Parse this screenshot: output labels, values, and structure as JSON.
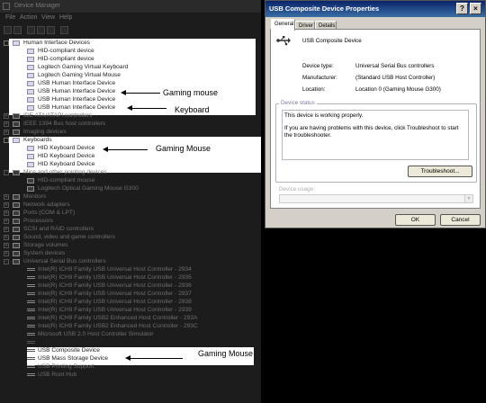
{
  "device_manager": {
    "title": "Device Manager",
    "menu": [
      "File",
      "Action",
      "View",
      "Help"
    ],
    "tree": [
      {
        "id": "hid-cat",
        "text": "Human Interface Devices",
        "level": 0,
        "expander": "-",
        "lit": true
      },
      {
        "id": "hid-1",
        "text": "HID-compliant device",
        "level": 1,
        "lit": true
      },
      {
        "id": "hid-2",
        "text": "HID-compliant device",
        "level": 1,
        "lit": true
      },
      {
        "id": "hid-3",
        "text": "Logitech Gaming Virtual Keyboard",
        "level": 1,
        "lit": true
      },
      {
        "id": "hid-4",
        "text": "Logitech Gaming Virtual Mouse",
        "level": 1,
        "lit": true
      },
      {
        "id": "hid-5",
        "text": "USB Human Interface Device",
        "level": 1,
        "lit": true
      },
      {
        "id": "hid-6",
        "text": "USB Human Interface Device",
        "level": 1,
        "lit": true
      },
      {
        "id": "hid-7",
        "text": "USB Human Interface Device",
        "level": 1,
        "lit": true
      },
      {
        "id": "hid-8",
        "text": "USB Human Interface Device",
        "level": 1,
        "lit": true
      },
      {
        "id": "ide",
        "text": "IDE ATA/ATAPI controllers",
        "level": 0,
        "expander": "+",
        "lit": false
      },
      {
        "id": "ieee",
        "text": "IEEE 1394 Bus host controllers",
        "level": 0,
        "expander": "+",
        "lit": false
      },
      {
        "id": "imaging",
        "text": "Imaging devices",
        "level": 0,
        "expander": "+",
        "lit": false
      },
      {
        "id": "kb-cat",
        "text": "Keyboards",
        "level": 0,
        "expander": "-",
        "lit": true
      },
      {
        "id": "kb-1",
        "text": "HID Keyboard Device",
        "level": 1,
        "lit": true
      },
      {
        "id": "kb-2",
        "text": "HID Keyboard Device",
        "level": 1,
        "lit": true
      },
      {
        "id": "kb-3",
        "text": "HID Keyboard Device",
        "level": 1,
        "lit": true
      },
      {
        "id": "mice-cat",
        "text": "Mice and other pointing devices",
        "level": 0,
        "expander": "-",
        "lit": false
      },
      {
        "id": "mice-1",
        "text": "HID-compliant mouse",
        "level": 1,
        "lit": false
      },
      {
        "id": "mice-2",
        "text": "Logitech Optical Gaming Mouse G300",
        "level": 1,
        "lit": false
      },
      {
        "id": "monitors",
        "text": "Monitors",
        "level": 0,
        "expander": "+",
        "lit": false
      },
      {
        "id": "net",
        "text": "Network adapters",
        "level": 0,
        "expander": "+",
        "lit": false
      },
      {
        "id": "ports",
        "text": "Ports (COM & LPT)",
        "level": 0,
        "expander": "+",
        "lit": false
      },
      {
        "id": "proc",
        "text": "Processors",
        "level": 0,
        "expander": "+",
        "lit": false
      },
      {
        "id": "scsi",
        "text": "SCSI and RAID controllers",
        "level": 0,
        "expander": "+",
        "lit": false
      },
      {
        "id": "sound",
        "text": "Sound, video and game controllers",
        "level": 0,
        "expander": "+",
        "lit": false
      },
      {
        "id": "storage",
        "text": "Storage volumes",
        "level": 0,
        "expander": "+",
        "lit": false
      },
      {
        "id": "system",
        "text": "System devices",
        "level": 0,
        "expander": "+",
        "lit": false
      },
      {
        "id": "usb-cat",
        "text": "Universal Serial Bus controllers",
        "level": 0,
        "expander": "-",
        "lit": false
      },
      {
        "id": "usb-1",
        "text": "Intel(R) ICH9 Family USB Universal Host Controller - 2934",
        "level": 1,
        "lit": false,
        "usb": true
      },
      {
        "id": "usb-2",
        "text": "Intel(R) ICH9 Family USB Universal Host Controller - 2935",
        "level": 1,
        "lit": false,
        "usb": true
      },
      {
        "id": "usb-3",
        "text": "Intel(R) ICH9 Family USB Universal Host Controller - 2936",
        "level": 1,
        "lit": false,
        "usb": true
      },
      {
        "id": "usb-4",
        "text": "Intel(R) ICH9 Family USB Universal Host Controller - 2937",
        "level": 1,
        "lit": false,
        "usb": true
      },
      {
        "id": "usb-5",
        "text": "Intel(R) ICH9 Family USB Universal Host Controller - 2938",
        "level": 1,
        "lit": false,
        "usb": true
      },
      {
        "id": "usb-6",
        "text": "Intel(R) ICH9 Family USB Universal Host Controller - 2939",
        "level": 1,
        "lit": false,
        "usb": true
      },
      {
        "id": "usb-7",
        "text": "Intel(R) ICH9 Family USB2 Enhanced Host Controller - 293A",
        "level": 1,
        "lit": false,
        "usb": true
      },
      {
        "id": "usb-8",
        "text": "Intel(R) ICH9 Family USB2 Enhanced Host Controller - 293C",
        "level": 1,
        "lit": false,
        "usb": true
      },
      {
        "id": "usb-9",
        "text": "Microsoft USB 2.0 Host Controller Simulator",
        "level": 1,
        "lit": false,
        "usb": true
      },
      {
        "id": "usb-10",
        "text": "USB Composite Device",
        "level": 1,
        "lit": true,
        "usb": true
      },
      {
        "id": "usb-11",
        "text": "USB Composite Device",
        "level": 1,
        "lit": true,
        "usb": true
      },
      {
        "id": "usb-12",
        "text": "USB Mass Storage Device",
        "level": 1,
        "lit": true,
        "usb": true
      },
      {
        "id": "usb-13",
        "text": "USB Printing Support",
        "level": 1,
        "lit": false,
        "usb": true
      },
      {
        "id": "usb-14",
        "text": "USB Root Hub",
        "level": 1,
        "lit": false,
        "usb": true
      }
    ],
    "annotations": {
      "gaming_mouse_1": "Gaming mouse",
      "keyboard": "Keyboard",
      "gaming_mouse_2": "Gaming Mouse",
      "gaming_mouse_3": "Gaming Mouse"
    }
  },
  "properties_dialog": {
    "title": "USB Composite Device Properties",
    "tabs": [
      "General",
      "Driver",
      "Details"
    ],
    "active_tab": "General",
    "device_name": "USB Composite Device",
    "fields": [
      {
        "label": "Device type:",
        "value": "Universal Serial Bus controllers"
      },
      {
        "label": "Manufacturer:",
        "value": "(Standard USB Host Controller)"
      },
      {
        "label": "Location:",
        "value": "Location 0 (Gaming Mouse G300)"
      }
    ],
    "device_status_legend": "Device status",
    "status_line1": "This device is working properly.",
    "status_line2": "If you are having problems with this device, click Troubleshoot to start",
    "status_line3": "the troubleshooter.",
    "troubleshoot_label": "Troubleshoot...",
    "device_usage_legend": "Device usage:",
    "ok_label": "OK",
    "cancel_label": "Cancel",
    "help_glyph": "?",
    "close_glyph": "×"
  }
}
